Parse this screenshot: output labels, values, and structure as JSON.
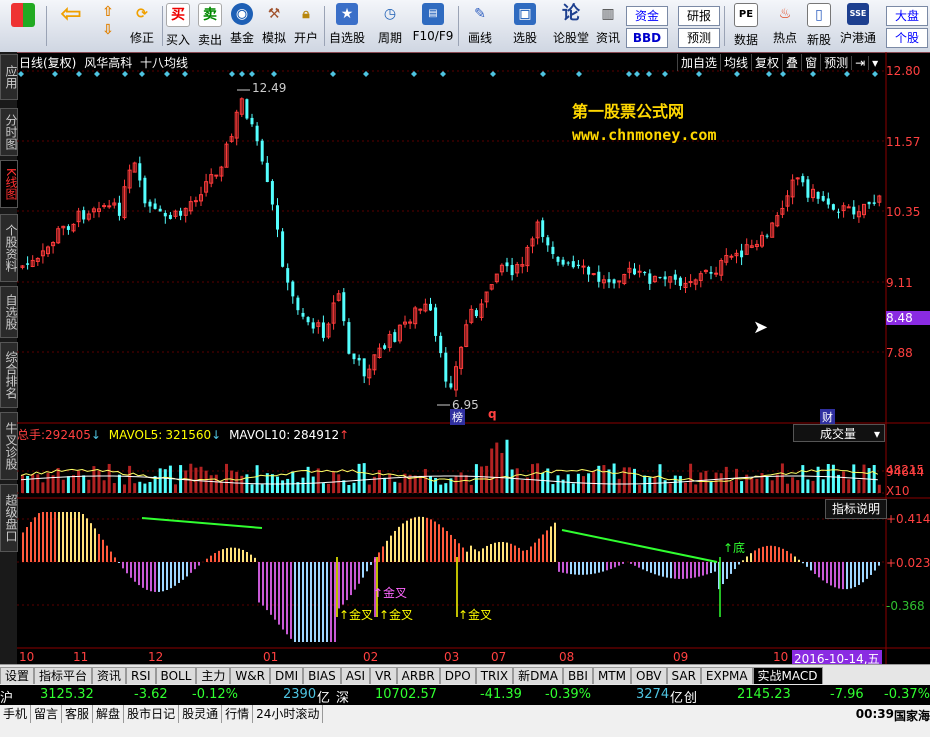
{
  "toolbar": {
    "items": [
      {
        "label": "",
        "icon": "windows-logo-icon"
      },
      {
        "label": "",
        "icon": "back-arrow-icon"
      },
      {
        "label": "修正",
        "icon": "refresh-icon"
      },
      {
        "label": "买入",
        "icon": "buy-icon",
        "glyph": "买"
      },
      {
        "label": "卖出",
        "icon": "sell-icon",
        "glyph": "卖"
      },
      {
        "label": "基金",
        "icon": "fund-icon"
      },
      {
        "label": "模拟",
        "icon": "hammer-icon"
      },
      {
        "label": "开户",
        "icon": "lock-icon"
      },
      {
        "label": "自选股",
        "icon": "star-folder-icon"
      },
      {
        "label": "周期",
        "icon": "clock-icon"
      },
      {
        "label": "F10/F9",
        "icon": "f10-icon"
      },
      {
        "label": "画线",
        "icon": "pencil-icon"
      },
      {
        "label": "选股",
        "icon": "screen-icon"
      },
      {
        "label": "论股堂",
        "icon": "discuss-icon",
        "glyph": "论"
      },
      {
        "label": "资讯",
        "icon": "news-icon"
      },
      {
        "label": "数据",
        "icon": "pe-icon"
      },
      {
        "label": "热点",
        "icon": "hot-icon"
      },
      {
        "label": "新股",
        "icon": "newstock-icon"
      },
      {
        "label": "沪港通",
        "icon": "sse-hke-icon"
      }
    ],
    "box_zijin": "资金",
    "box_bbd": "BBD",
    "box_yanbao": "研报",
    "box_yuce": "预测",
    "box_dapan": "大盘",
    "box_gegu": "个股"
  },
  "sidebar": {
    "tabs": [
      "应用",
      "分时图",
      "K线图",
      "个股资料",
      "自选股",
      "综合排名",
      "牛叉诊股",
      "超级盘口"
    ]
  },
  "header": {
    "period": "日线(复权)",
    "stock_name": "风华高科",
    "ma_label": "十八均线",
    "buttons": [
      "加自选",
      "均线",
      "复权",
      "叠",
      "窗",
      "预测"
    ]
  },
  "watermark": {
    "line1": "第一股票公式网",
    "line2": "www.chnmoney.com"
  },
  "price_axis": {
    "labels": [
      "12.80",
      "11.57",
      "10.35",
      "9.11",
      "7.88"
    ],
    "current": "8.48",
    "high_mark": "12.49",
    "low_mark": "6.95"
  },
  "markers": {
    "bang": "榜",
    "q": "q",
    "cai": "财"
  },
  "volume": {
    "total_label": "总手:",
    "total_value": "292405",
    "ma5_label": "MAVOL5:",
    "ma5_value": "321560",
    "ma10_label": "MAVOL10:",
    "ma10_value": "284912",
    "panel_title": "成交量",
    "axis_labels": [
      "94644",
      "48215",
      "X10"
    ]
  },
  "macd": {
    "panel_title": "指标说明",
    "axis_labels": [
      "+0.414",
      "+0.023",
      "-0.368"
    ],
    "signals": [
      "↑底",
      "↑金叉",
      "↑金叉",
      "↑金叉",
      "↑金叉"
    ]
  },
  "x_axis": {
    "labels": [
      "10",
      "11",
      "12",
      "01",
      "02",
      "03",
      "07",
      "08",
      "09",
      "10"
    ],
    "date_box": "2016-10-14,五"
  },
  "bottom_tabs": [
    "设置",
    "指标平台",
    "资讯",
    "RSI",
    "BOLL",
    "主力",
    "W&R",
    "DMI",
    "BIAS",
    "ASI",
    "VR",
    "ARBR",
    "DPO",
    "TRIX",
    "新DMA",
    "BBI",
    "MTM",
    "OBV",
    "SAR",
    "EXPMA",
    "实战MACD"
  ],
  "market": {
    "sh_label": "沪",
    "sh_index": "3125.32",
    "sh_change": "-3.62",
    "sh_pct": "-0.12%",
    "sh_amount": "2390",
    "sh_unit": "亿",
    "sz_label": "深",
    "sz_index": "10702.57",
    "sz_change": "-41.39",
    "sz_pct": "-0.39%",
    "sz_amount": "3274",
    "sz_unit": "亿",
    "cy_label": "创",
    "cy_index": "2145.23",
    "cy_change": "-7.96",
    "cy_pct": "-0.37%"
  },
  "status_bar": {
    "items": [
      "手机",
      "留言",
      "客服",
      "解盘",
      "股市日记",
      "股灵通",
      "行情",
      "24小时滚动"
    ],
    "time": "00:39",
    "provider": "国家海"
  }
}
